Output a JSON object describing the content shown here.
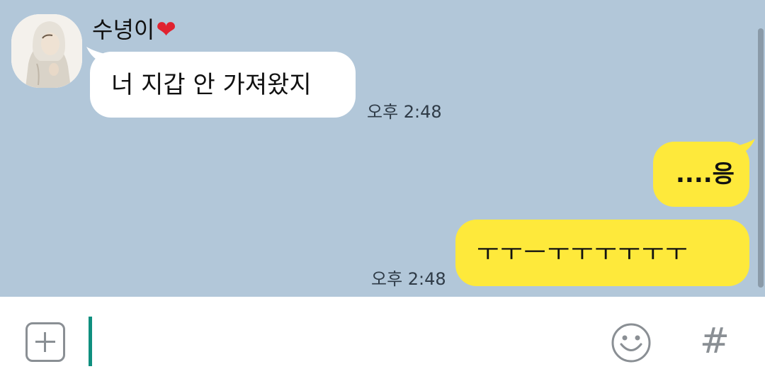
{
  "chat": {
    "sender_name": "수녕이",
    "sender_emoji": "❤",
    "incoming_message": "너 지갑 안 가져왔지",
    "incoming_time": "오후 2:48",
    "outgoing_messages": [
      "....응",
      "ㅜㅜㅡㅜㅜㅜㅜㅜㅜ"
    ],
    "outgoing_time": "오후 2:48"
  },
  "input": {
    "value": "",
    "add_icon": "plus-square-icon",
    "emoji_icon": "smiley-icon",
    "hash_label": "#"
  },
  "colors": {
    "chat_background": "#b2c7d9",
    "outgoing_bubble": "#fee93b",
    "incoming_bubble": "#ffffff",
    "caret": "#0f8f7f",
    "icon_gray": "#8a8f94"
  }
}
